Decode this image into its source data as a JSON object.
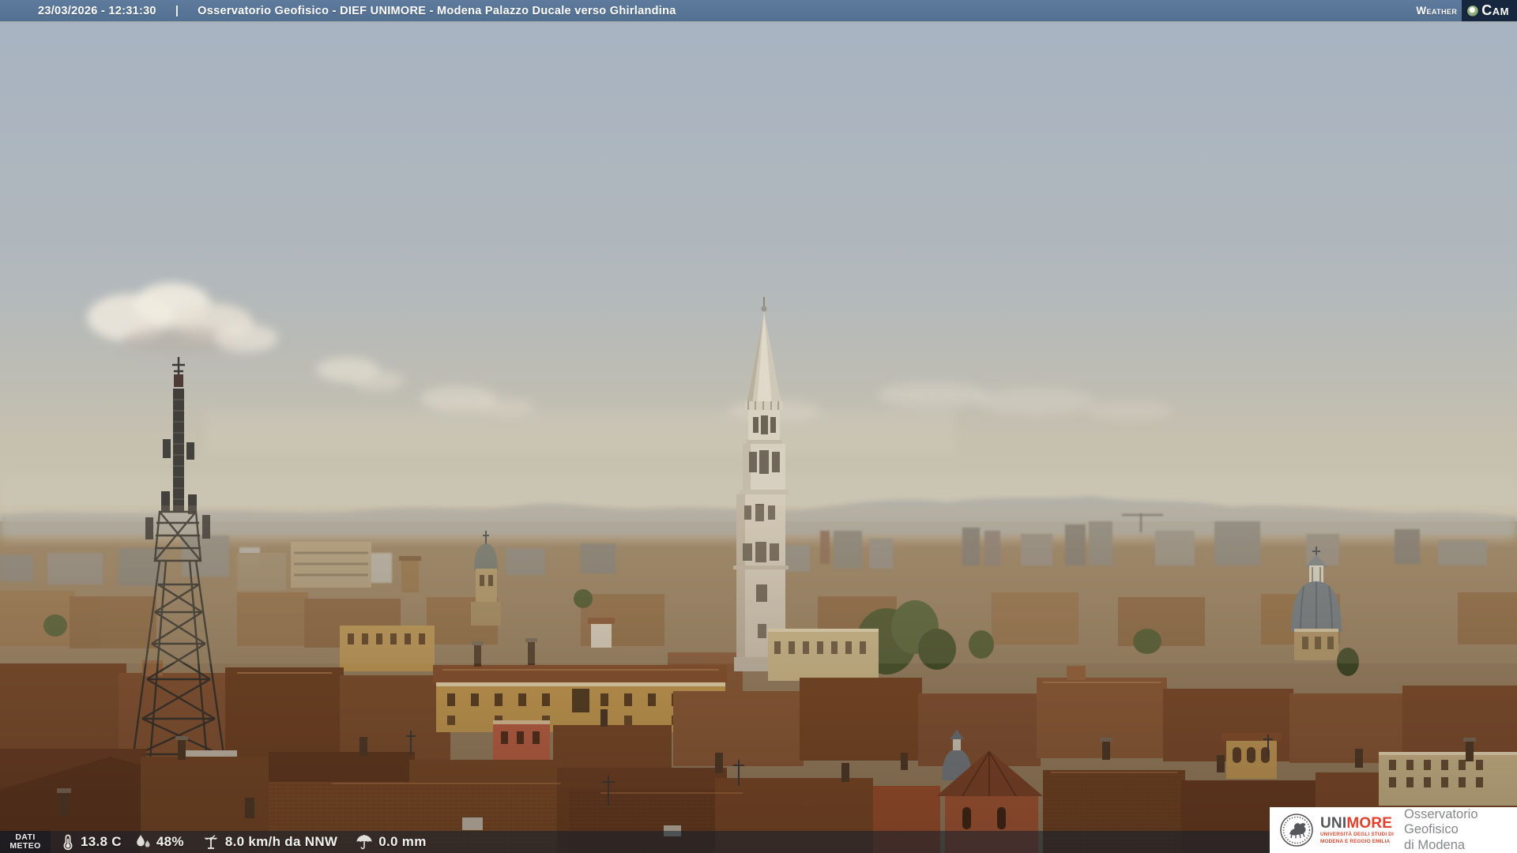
{
  "header": {
    "timestamp": "23/03/2026 - 12:31:30",
    "separator": "|",
    "title": "Osservatorio Geofisico - DIEF UNIMORE - Modena Palazzo Ducale verso Ghirlandina",
    "logo": {
      "weather": "Weather",
      "cam": "Cam"
    }
  },
  "footer": {
    "label_line1": "DATI",
    "label_line2": "METEO",
    "temperature": "13.8 C",
    "humidity": "48%",
    "wind": "8.0 km/h da NNW",
    "precipitation": "0.0 mm"
  },
  "branding": {
    "uni": "UNI",
    "more": "MORE",
    "university_line1": "UNIVERSITÀ DEGLI STUDI DI",
    "university_line2": "MODENA E REGGIO EMILIA",
    "observatory_line1": "Osservatorio Geofisico",
    "observatory_line2": "di Modena"
  },
  "icons": {
    "globe": "globe-icon",
    "temperature": "thermometer-icon",
    "humidity": "water-drops-icon",
    "wind": "anemometer-icon",
    "precipitation": "umbrella-icon",
    "seal": "unimore-seal"
  },
  "colors": {
    "topbar": "#587494",
    "logo_navy": "#16273f",
    "unimore_red": "#e2402c",
    "overlay": "rgba(14,28,46,0.52)",
    "sky_top": "#a7b3c2",
    "sky_horizon": "#cdc6b2"
  }
}
